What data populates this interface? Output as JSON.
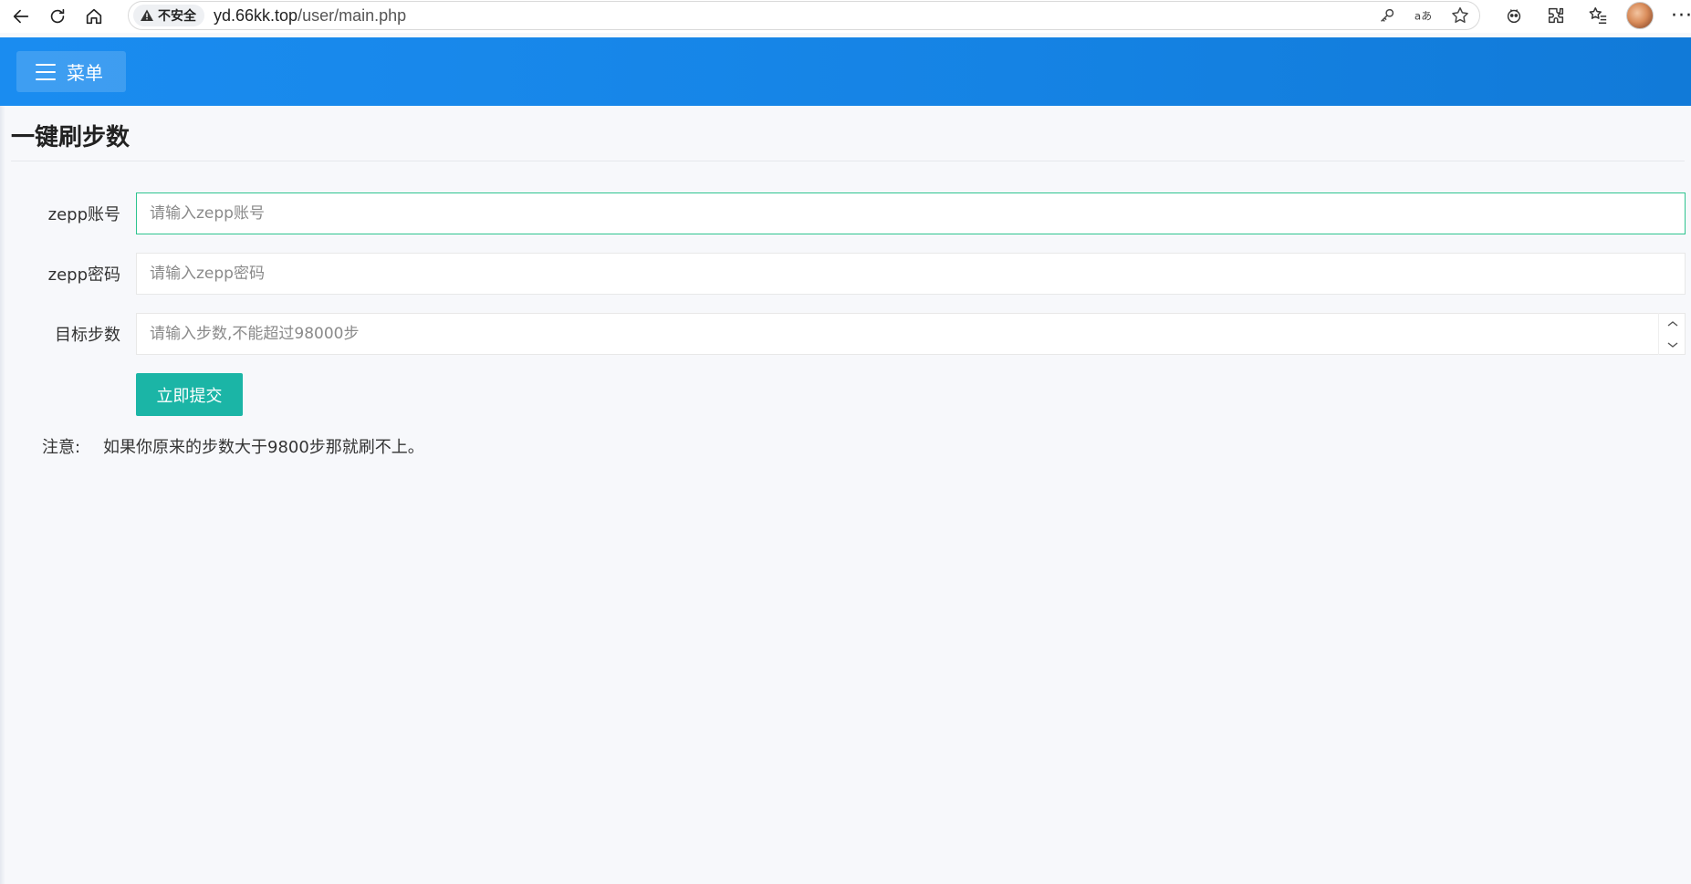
{
  "browser": {
    "security_label": "不安全",
    "url_host": "yd.66kk.top",
    "url_path": "/user/main.php",
    "address_icons": [
      "key-icon",
      "read-aloud-icon",
      "favorite-star-icon"
    ],
    "toolbar_icons": [
      "copilot-icon",
      "extensions-icon",
      "favorites-list-icon",
      "profile-avatar",
      "more-icon"
    ],
    "more_label": "···"
  },
  "header": {
    "menu_label": "菜单",
    "accent_color": "#1a8cf0"
  },
  "page": {
    "title": "一键刷步数"
  },
  "form": {
    "account": {
      "label": "zepp账号",
      "placeholder": "请输入zepp账号",
      "value": ""
    },
    "password": {
      "label": "zepp密码",
      "placeholder": "请输入zepp密码",
      "value": ""
    },
    "steps": {
      "label": "目标步数",
      "placeholder": "请输入步数,不能超过98000步",
      "value": ""
    },
    "submit_label": "立即提交",
    "submit_color": "#1bb5a6"
  },
  "notice": {
    "label": "注意:",
    "text": "如果你原来的步数大于9800步那就刷不上。"
  }
}
